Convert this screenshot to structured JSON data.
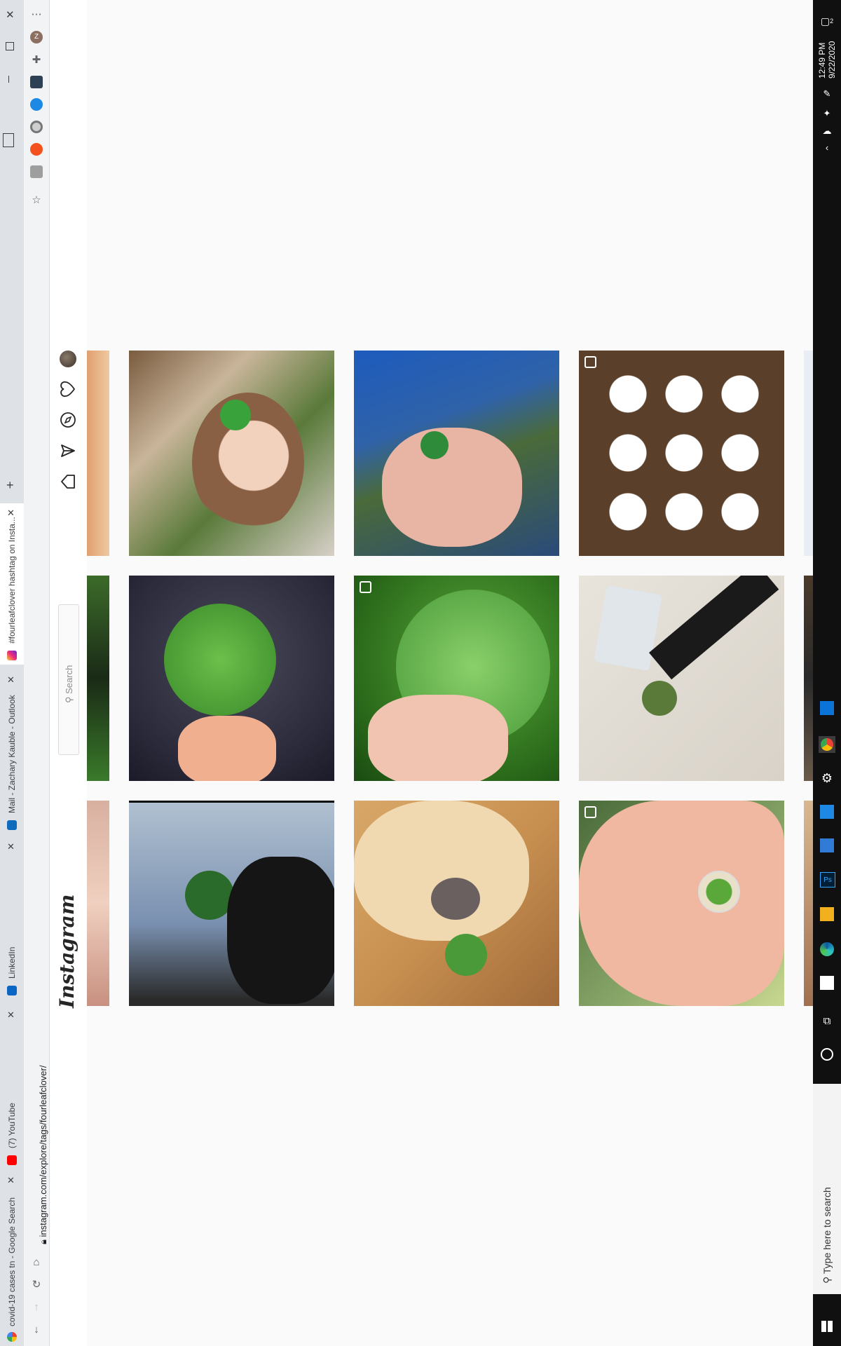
{
  "browser": {
    "url": "instagram.com/explore/tags/fourleafclover/",
    "tabs": [
      {
        "title": "#fourleafclover hashtag on Insta...",
        "active": true
      },
      {
        "title": "Mail - Zachary Kauble - Outlook",
        "active": false
      },
      {
        "title": "LinkedIn",
        "active": false
      },
      {
        "title": "(7) YouTube",
        "active": false
      },
      {
        "title": "covid-19 cases tn - Google Search",
        "active": false
      }
    ],
    "new_tab_label": "+",
    "ext_avatar_letter": "Z"
  },
  "instagram": {
    "logo": "Instagram",
    "search_placeholder": "Search",
    "nav_icons": [
      "home-icon",
      "direct-icon",
      "explore-icon",
      "activity-heart-icon",
      "profile-avatar"
    ]
  },
  "posts": [
    {
      "row": 1,
      "col": 1,
      "desc": "girl-with-clover-hairclip",
      "multi": false
    },
    {
      "row": 1,
      "col": 2,
      "desc": "hands-holding-clover",
      "multi": false
    },
    {
      "row": 1,
      "col": 3,
      "desc": "white-clover-cutouts",
      "multi": true
    },
    {
      "row": 2,
      "col": 1,
      "desc": "clover-fingertips-dark",
      "multi": false
    },
    {
      "row": 2,
      "col": 2,
      "desc": "clover-closeup-grass",
      "multi": true
    },
    {
      "row": 2,
      "col": 3,
      "desc": "clover-pen-eraser",
      "multi": false
    },
    {
      "row": 3,
      "col": 1,
      "desc": "clover-sky-silhouette",
      "multi": false
    },
    {
      "row": 3,
      "col": 2,
      "desc": "golden-retriever-clover",
      "multi": false
    },
    {
      "row": 3,
      "col": 3,
      "desc": "clover-pendant-hand",
      "multi": true
    }
  ],
  "taskbar": {
    "search_placeholder": "Type here to search",
    "time": "12:49 PM",
    "date": "9/22/2020",
    "notification_count": "2"
  },
  "colors": {
    "ig_border": "#dbdbdb",
    "taskbar_bg": "#101010",
    "tab_strip": "#dee1e6"
  }
}
